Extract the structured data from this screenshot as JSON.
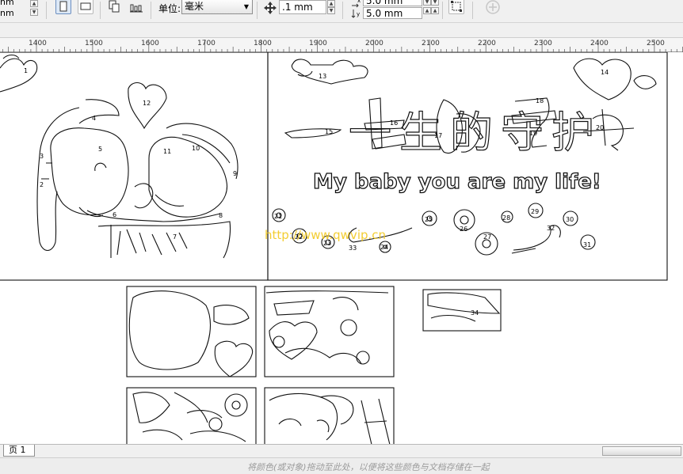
{
  "toolbar": {
    "unit_label": "单位:",
    "unit_value": "毫米",
    "nudge_value": ".1 mm",
    "dup_x_value": "5.0 mm",
    "dup_y_value": "5.0 mm",
    "left_field_top": "nm",
    "left_field_bottom": "nm"
  },
  "ruler": {
    "ticks": [
      "1400",
      "1500",
      "1600",
      "1700",
      "1800",
      "1900",
      "2000",
      "2100",
      "2200",
      "2300",
      "2400",
      "2500"
    ]
  },
  "artwork": {
    "title_chinese": "一生的守护",
    "slogan": "My baby you are my life!",
    "watermark": "http://www.qwvip.cn",
    "numbers": [
      "1",
      "2",
      "3",
      "4",
      "5",
      "6",
      "7",
      "8",
      "9",
      "10",
      "11",
      "12",
      "13",
      "14",
      "15",
      "16",
      "17",
      "18",
      "19",
      "20",
      "21",
      "22",
      "23",
      "24",
      "25",
      "26",
      "27",
      "28",
      "29",
      "30",
      "31",
      "32",
      "33",
      "34"
    ]
  },
  "page_tabs": {
    "page1": "页 1"
  },
  "color_bar": {
    "hint": "将颜色(或对象)拖动至此处，以便将这些颜色与文档存储在一起"
  }
}
